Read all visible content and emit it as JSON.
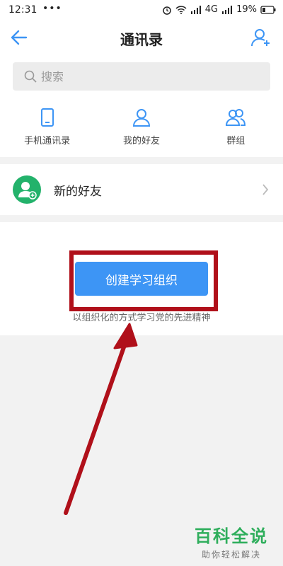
{
  "status_bar": {
    "time": "12:31",
    "dots": "•••",
    "network": "4G",
    "battery": "19%"
  },
  "header": {
    "title": "通讯录"
  },
  "search": {
    "placeholder": "搜索"
  },
  "shortcuts": [
    {
      "label": "手机通讯录",
      "icon": "phone-icon"
    },
    {
      "label": "我的好友",
      "icon": "person-icon"
    },
    {
      "label": "群组",
      "icon": "group-icon"
    }
  ],
  "new_friend": {
    "label": "新的好友"
  },
  "organization": {
    "button_label": "创建学习组织",
    "description": "以组织化的方式学习党的先进精神"
  },
  "watermark": {
    "title": "百科全说",
    "subtitle": "助你轻松解决"
  },
  "colors": {
    "accent": "#3d95f5",
    "green": "#23b26b",
    "highlight": "#b0101a",
    "watermark": "#2fae5c"
  }
}
